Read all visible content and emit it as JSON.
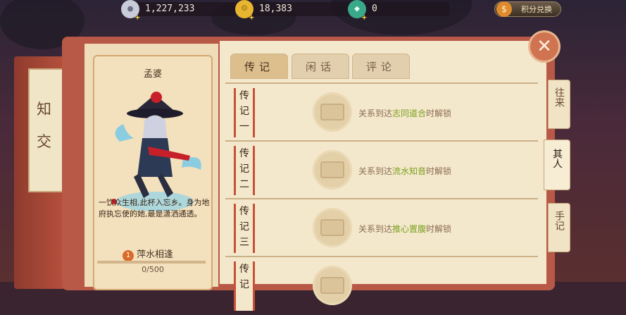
{
  "currencies": {
    "silver": {
      "value": "1,227,233",
      "color": "#c8cbd8",
      "icon": "silver-coin-icon"
    },
    "gold": {
      "value": "18,383",
      "color": "#e8b530",
      "icon": "gold-coin-icon"
    },
    "jade": {
      "value": "0",
      "color": "#3aa98a",
      "icon": "jade-icon"
    },
    "exchange_label": "积分兑换"
  },
  "left_book": {
    "tab_chars": [
      "知",
      "交"
    ]
  },
  "character": {
    "name": "孟婆",
    "description": "一饮众生相,此杯入忘乡。身为地府执忘使的她,最是潇洒通透。",
    "bond_label": "萍水相逢",
    "bond_level": "1",
    "bond_progress": "0/500"
  },
  "tabs": [
    {
      "label": "传记",
      "active": true
    },
    {
      "label": "闲话",
      "active": false
    },
    {
      "label": "评论",
      "active": false
    }
  ],
  "stories": [
    {
      "label": "传记一",
      "prefix": "关系到达",
      "highlight": "志同道合",
      "suffix": "时解锁"
    },
    {
      "label": "传记二",
      "prefix": "关系到达",
      "highlight": "流水知音",
      "suffix": "时解锁"
    },
    {
      "label": "传记三",
      "prefix": "关系到达",
      "highlight": "推心置腹",
      "suffix": "时解锁"
    },
    {
      "label": "传记",
      "prefix": "",
      "highlight": "",
      "suffix": ""
    }
  ],
  "side_tabs": [
    {
      "label": "往来",
      "active": false
    },
    {
      "label": "其人",
      "active": true
    },
    {
      "label": "手记",
      "active": false
    }
  ],
  "close_label": "✕"
}
